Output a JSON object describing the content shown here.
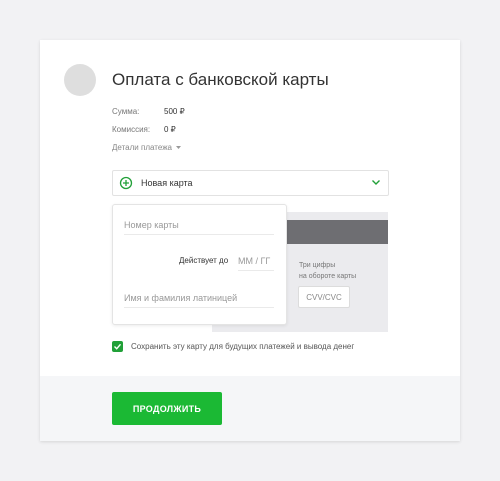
{
  "header": {
    "title": "Оплата с банковской карты"
  },
  "payment": {
    "amount_label": "Сумма:",
    "amount_value": "500 ₽",
    "fee_label": "Комиссия:",
    "fee_value": "0 ₽",
    "details_label": "Детали платежа"
  },
  "card_select": {
    "label": "Новая карта",
    "icon": "plus-circle-icon",
    "chevron": "chevron-down-icon"
  },
  "card_form": {
    "number_placeholder": "Номер карты",
    "expiry_label": "Действует до",
    "expiry_placeholder": "ММ / ГГ",
    "holder_placeholder": "Имя и фамилия латиницей",
    "cvv_hint_line1": "Три цифры",
    "cvv_hint_line2": "на обороте карты",
    "cvv_placeholder": "CVV/CVC"
  },
  "save_card": {
    "label": "Сохранить эту карту для будущих платежей и вывода денег",
    "checked": true
  },
  "submit": {
    "label": "ПРОДОЛЖИТЬ"
  },
  "colors": {
    "accent_green": "#1bb934",
    "checkbox_green": "#21a038",
    "stripe_gray": "#6e6e72"
  }
}
